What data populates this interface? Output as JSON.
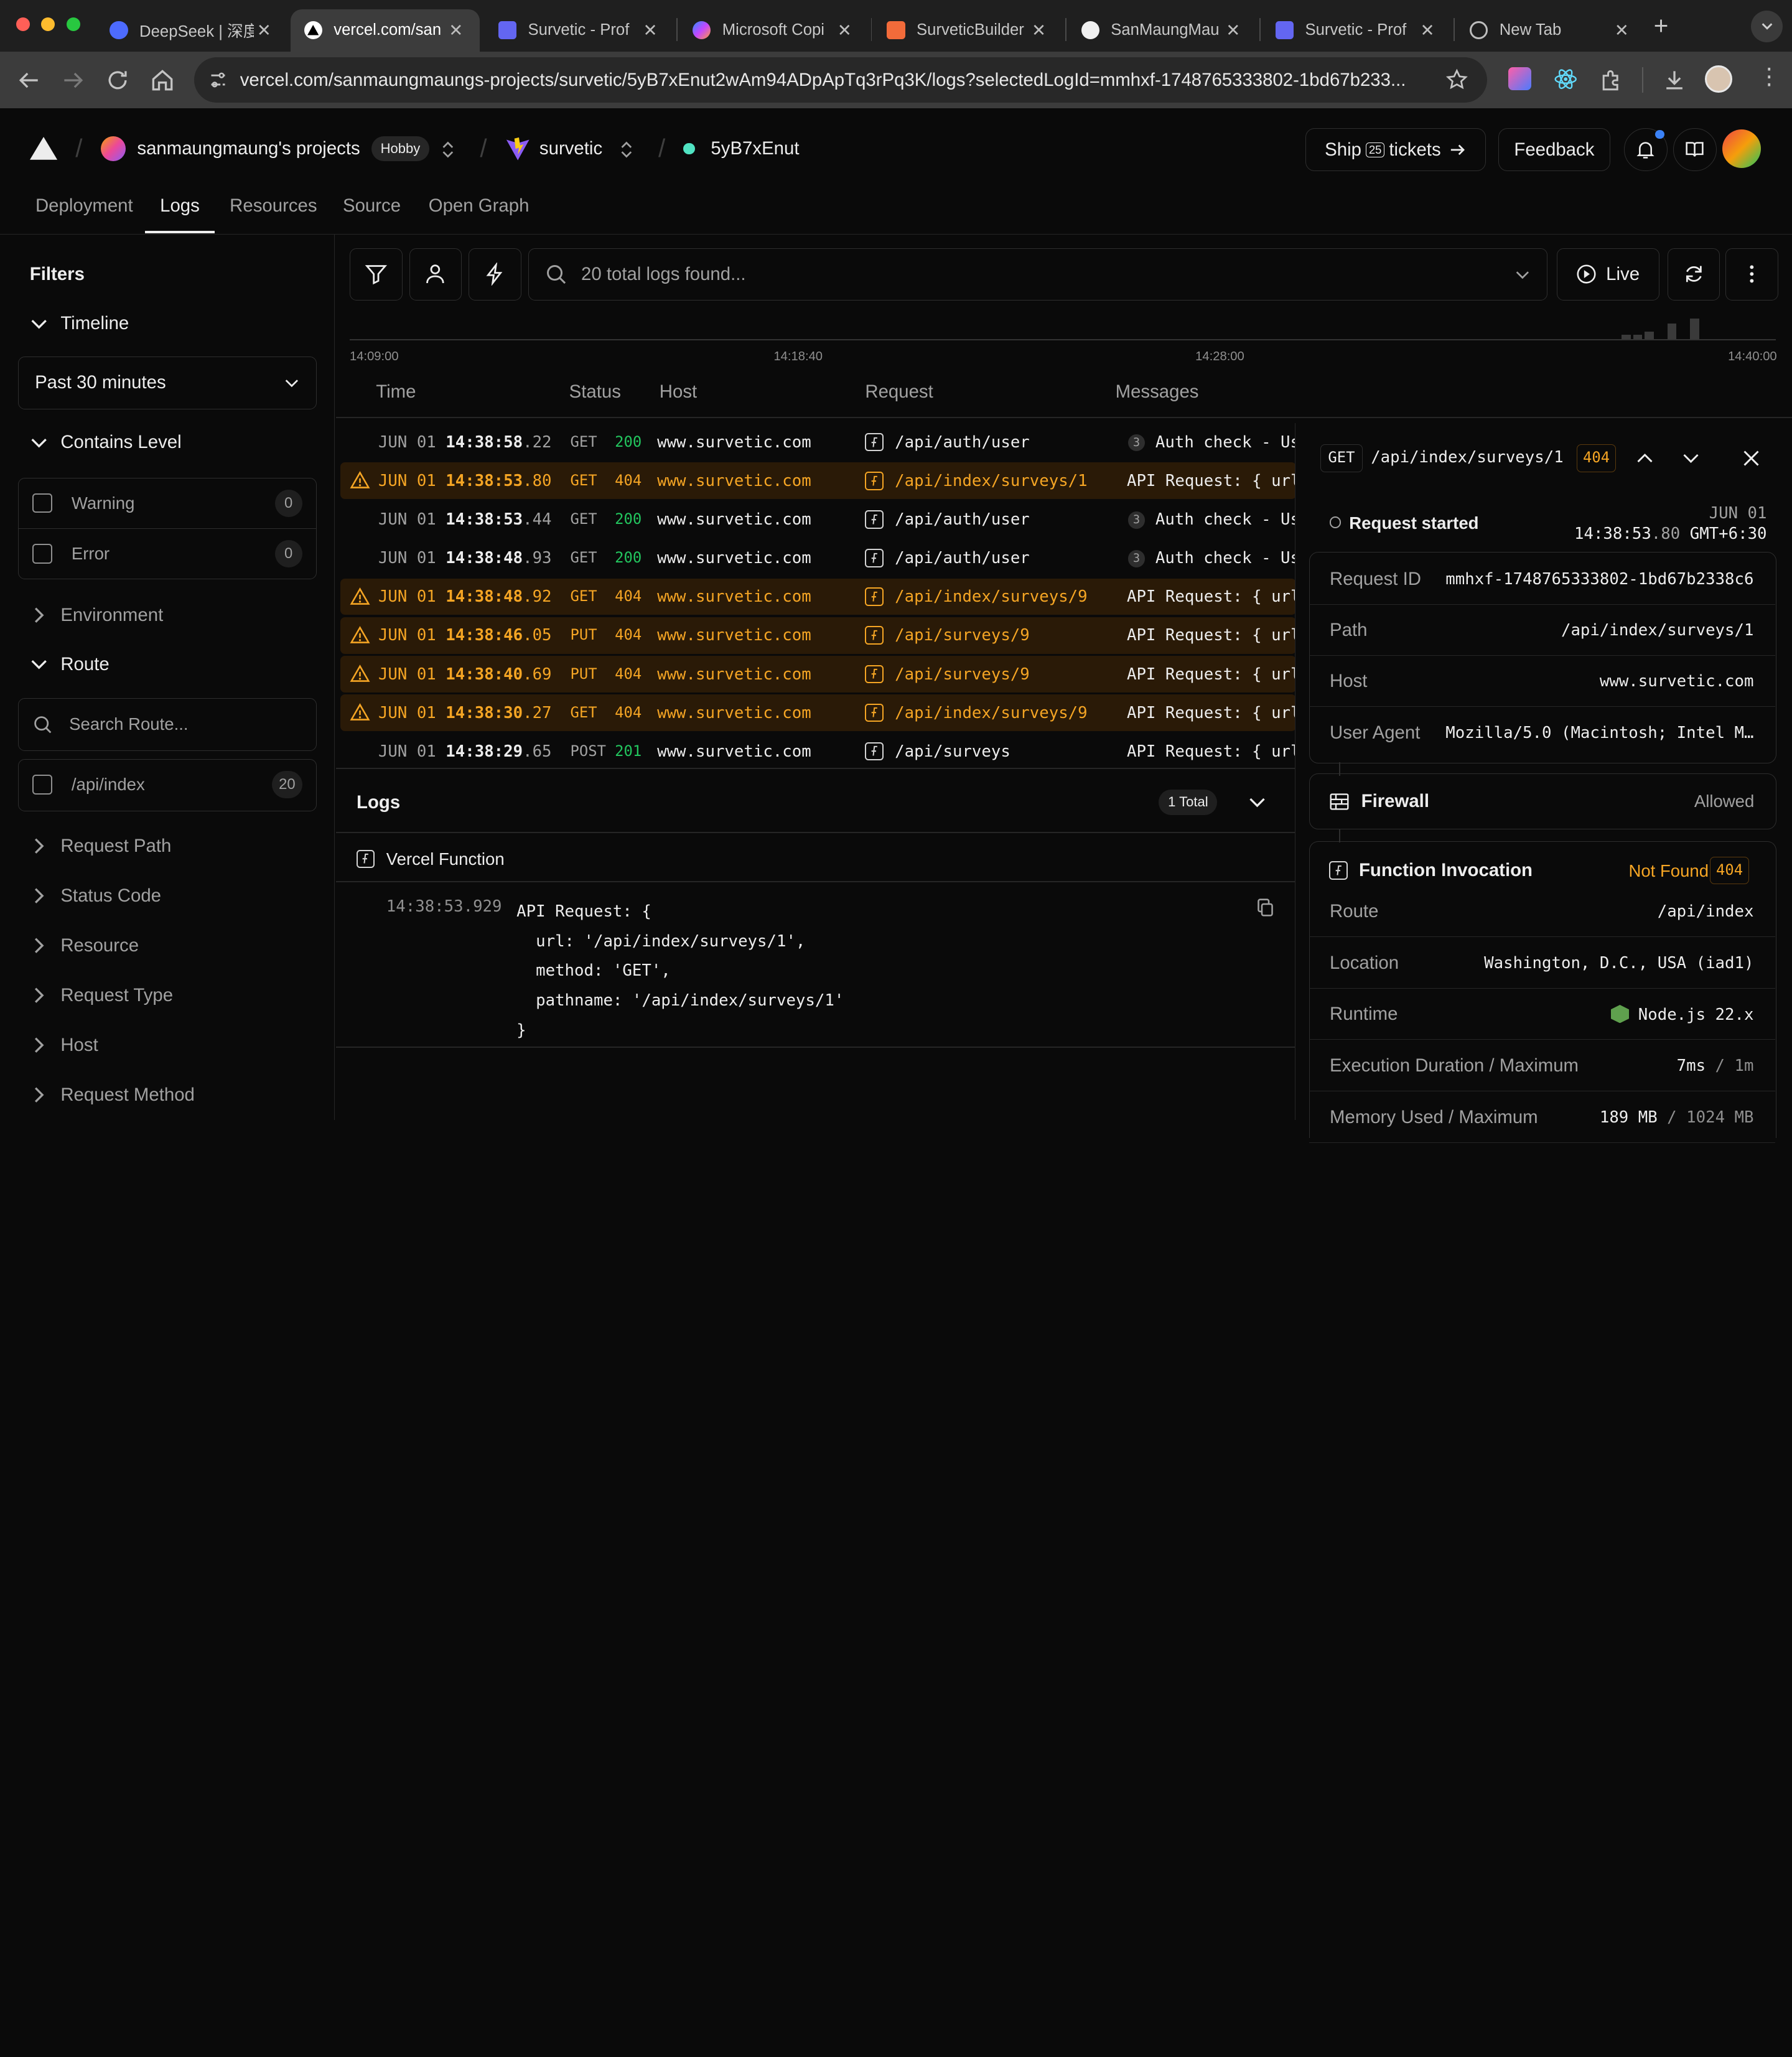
{
  "browser": {
    "tabs": [
      {
        "title": "DeepSeek | 深度",
        "icon": "deepseek-icon"
      },
      {
        "title": "vercel.com/san",
        "icon": "vercel-icon"
      },
      {
        "title": "Survetic - Prof",
        "icon": "docs-icon"
      },
      {
        "title": "Microsoft Copi",
        "icon": "copilot-icon"
      },
      {
        "title": "SurveticBuilder",
        "icon": "figma-icon"
      },
      {
        "title": "SanMaungMau",
        "icon": "github-icon"
      },
      {
        "title": "Survetic - Prof",
        "icon": "docs-icon"
      },
      {
        "title": "New Tab",
        "icon": "chrome-icon"
      }
    ],
    "url": "vercel.com/sanmaungmaungs-projects/survetic/5yB7xEnut2wAm94ADpApTq3rPq3K/logs?selectedLogId=mmhxf-1748765333802-1bd67b233..."
  },
  "header": {
    "team": "sanmaungmaung's projects",
    "plan": "Hobby",
    "project": "survetic",
    "deployment": "5yB7xEnut",
    "ship_prefix": "Ship",
    "ship_count": "25",
    "ship_suffix": "tickets",
    "feedback": "Feedback",
    "nav": [
      "Deployment",
      "Logs",
      "Resources",
      "Source",
      "Open Graph"
    ]
  },
  "sidebar": {
    "title": "Filters",
    "timeline_label": "Timeline",
    "timeline_value": "Past 30 minutes",
    "level_label": "Contains Level",
    "levels": [
      {
        "label": "Warning",
        "count": "0"
      },
      {
        "label": "Error",
        "count": "0"
      }
    ],
    "environment": "Environment",
    "route_label": "Route",
    "route_placeholder": "Search Route...",
    "route_option": {
      "label": "/api/index",
      "count": "20"
    },
    "collapsed": [
      "Request Path",
      "Status Code",
      "Resource",
      "Request Type",
      "Host",
      "Request Method"
    ]
  },
  "toolbar": {
    "search_text": "20 total logs found...",
    "live_label": "Live"
  },
  "timeline_axis": [
    "14:09:00",
    "14:18:40",
    "14:28:00",
    "14:40:00"
  ],
  "histogram": [
    1,
    1,
    2,
    0,
    4,
    0,
    5
  ],
  "columns": [
    "Time",
    "Status",
    "Host",
    "Request",
    "Messages"
  ],
  "rows": [
    {
      "date": "JUN 01",
      "time": "14:38:58",
      "ms": ".22",
      "method": "GET",
      "status": "200",
      "host": "www.survetic.com",
      "request": "/api/auth/user",
      "count": "3",
      "message": "Auth check - Us",
      "warn": false
    },
    {
      "date": "JUN 01",
      "time": "14:38:53",
      "ms": ".80",
      "method": "GET",
      "status": "404",
      "host": "www.survetic.com",
      "request": "/api/index/surveys/1",
      "count": "",
      "message": "API Request: { url",
      "warn": true
    },
    {
      "date": "JUN 01",
      "time": "14:38:53",
      "ms": ".44",
      "method": "GET",
      "status": "200",
      "host": "www.survetic.com",
      "request": "/api/auth/user",
      "count": "3",
      "message": "Auth check - Us",
      "warn": false
    },
    {
      "date": "JUN 01",
      "time": "14:38:48",
      "ms": ".93",
      "method": "GET",
      "status": "200",
      "host": "www.survetic.com",
      "request": "/api/auth/user",
      "count": "3",
      "message": "Auth check - Us",
      "warn": false
    },
    {
      "date": "JUN 01",
      "time": "14:38:48",
      "ms": ".92",
      "method": "GET",
      "status": "404",
      "host": "www.survetic.com",
      "request": "/api/index/surveys/9",
      "count": "",
      "message": "API Request: { url",
      "warn": true
    },
    {
      "date": "JUN 01",
      "time": "14:38:46",
      "ms": ".05",
      "method": "PUT",
      "status": "404",
      "host": "www.survetic.com",
      "request": "/api/surveys/9",
      "count": "",
      "message": "API Request: { url",
      "warn": true
    },
    {
      "date": "JUN 01",
      "time": "14:38:40",
      "ms": ".69",
      "method": "PUT",
      "status": "404",
      "host": "www.survetic.com",
      "request": "/api/surveys/9",
      "count": "",
      "message": "API Request: { url",
      "warn": true
    },
    {
      "date": "JUN 01",
      "time": "14:38:30",
      "ms": ".27",
      "method": "GET",
      "status": "404",
      "host": "www.survetic.com",
      "request": "/api/index/surveys/9",
      "count": "",
      "message": "API Request: { url",
      "warn": true
    },
    {
      "date": "JUN 01",
      "time": "14:38:29",
      "ms": ".65",
      "method": "POST",
      "status": "201",
      "host": "www.survetic.com",
      "request": "/api/surveys",
      "count": "",
      "message": "API Request: { url",
      "warn": false
    }
  ],
  "logs_panel": {
    "title": "Logs",
    "total": "1 Total",
    "function_label": "Vercel Function",
    "timestamp": "14:38:53.929",
    "lines": [
      "API Request: {",
      "  url: '/api/index/surveys/1',",
      "  method: 'GET',",
      "  pathname: '/api/index/surveys/1'",
      "}"
    ]
  },
  "detail": {
    "method": "GET",
    "path": "/api/index/surveys/1",
    "status": "404",
    "started_label": "Request started",
    "date": "JUN 01",
    "time": "14:38:53",
    "ms": ".80",
    "tz": "GMT+6:30",
    "fields": [
      {
        "key": "Request ID",
        "value": "mmhxf-1748765333802-1bd67b2338c6"
      },
      {
        "key": "Path",
        "value": "/api/index/surveys/1"
      },
      {
        "key": "Host",
        "value": "www.survetic.com"
      },
      {
        "key": "User Agent",
        "value": "Mozilla/5.0 (Macintosh; Intel M…"
      }
    ],
    "firewall_label": "Firewall",
    "firewall_value": "Allowed",
    "function_label": "Function Invocation",
    "function_status": "Not Found",
    "function_code": "404",
    "invocation": [
      {
        "key": "Route",
        "value": "/api/index"
      },
      {
        "key": "Location",
        "value": "Washington, D.C., USA (iad1)"
      },
      {
        "key": "Runtime",
        "value": "Node.js 22.x"
      },
      {
        "key": "Execution Duration / Maximum",
        "value": "7ms",
        "max": "1m"
      },
      {
        "key": "Memory Used / Maximum",
        "value": "189 MB",
        "max": "1024 MB"
      }
    ]
  },
  "colors": {
    "warning": "#f5a524",
    "success": "#22c55e",
    "background": "#0a0a0a"
  }
}
